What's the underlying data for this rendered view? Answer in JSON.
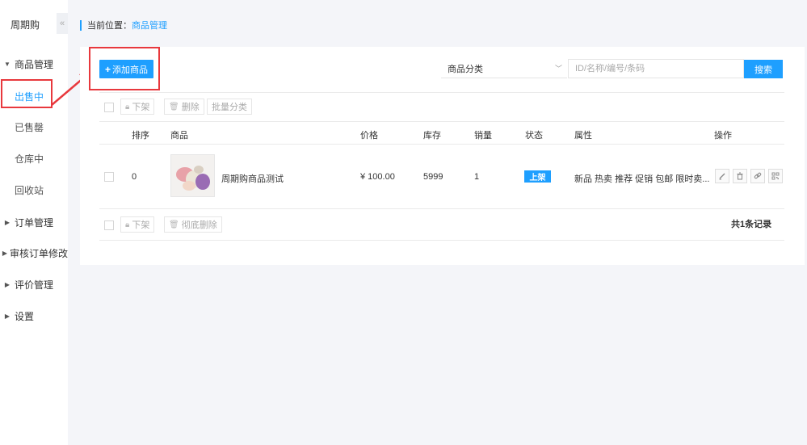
{
  "app": {
    "name": "周期购",
    "collapse_glyph": "«"
  },
  "sidebar": {
    "groups": [
      {
        "label": "商品管理",
        "expanded": true
      },
      {
        "label": "订单管理",
        "expanded": false
      },
      {
        "label": "审核订单修改",
        "expanded": false
      },
      {
        "label": "评价管理",
        "expanded": false
      },
      {
        "label": "设置",
        "expanded": false
      }
    ],
    "items": [
      {
        "label": "出售中",
        "active": true
      },
      {
        "label": "已售罄",
        "active": false
      },
      {
        "label": "仓库中",
        "active": false
      },
      {
        "label": "回收站",
        "active": false
      }
    ]
  },
  "breadcrumb": {
    "prefix": "当前位置：",
    "current": "商品管理"
  },
  "toolbar": {
    "add_label": "添加商品",
    "category_value": "商品分类",
    "search_placeholder": "ID/名称/编号/条码",
    "search_label": "搜索"
  },
  "bulk_top": {
    "offline": "下架",
    "delete": "删除",
    "batch_category": "批量分类"
  },
  "bulk_bottom": {
    "offline": "下架",
    "delete_forever": "彻底删除"
  },
  "table": {
    "headers": [
      "排序",
      "商品",
      "价格",
      "库存",
      "销量",
      "状态",
      "属性",
      "操作"
    ],
    "rows": [
      {
        "sort": "0",
        "product_name": "周期购商品测试",
        "price": "¥ 100.00",
        "stock": "5999",
        "sales": "1",
        "status": "上架",
        "attributes": "新品 热卖 推荐 促销 包邮 限时卖..."
      }
    ]
  },
  "footer": {
    "record_count": "共1条记录"
  },
  "colors": {
    "accent": "#1e9fff",
    "annotation": "#e8383d"
  },
  "icons": {
    "edit": "edit-icon",
    "delete": "trash-icon",
    "link": "link-icon",
    "qrcode": "qrcode-icon"
  }
}
